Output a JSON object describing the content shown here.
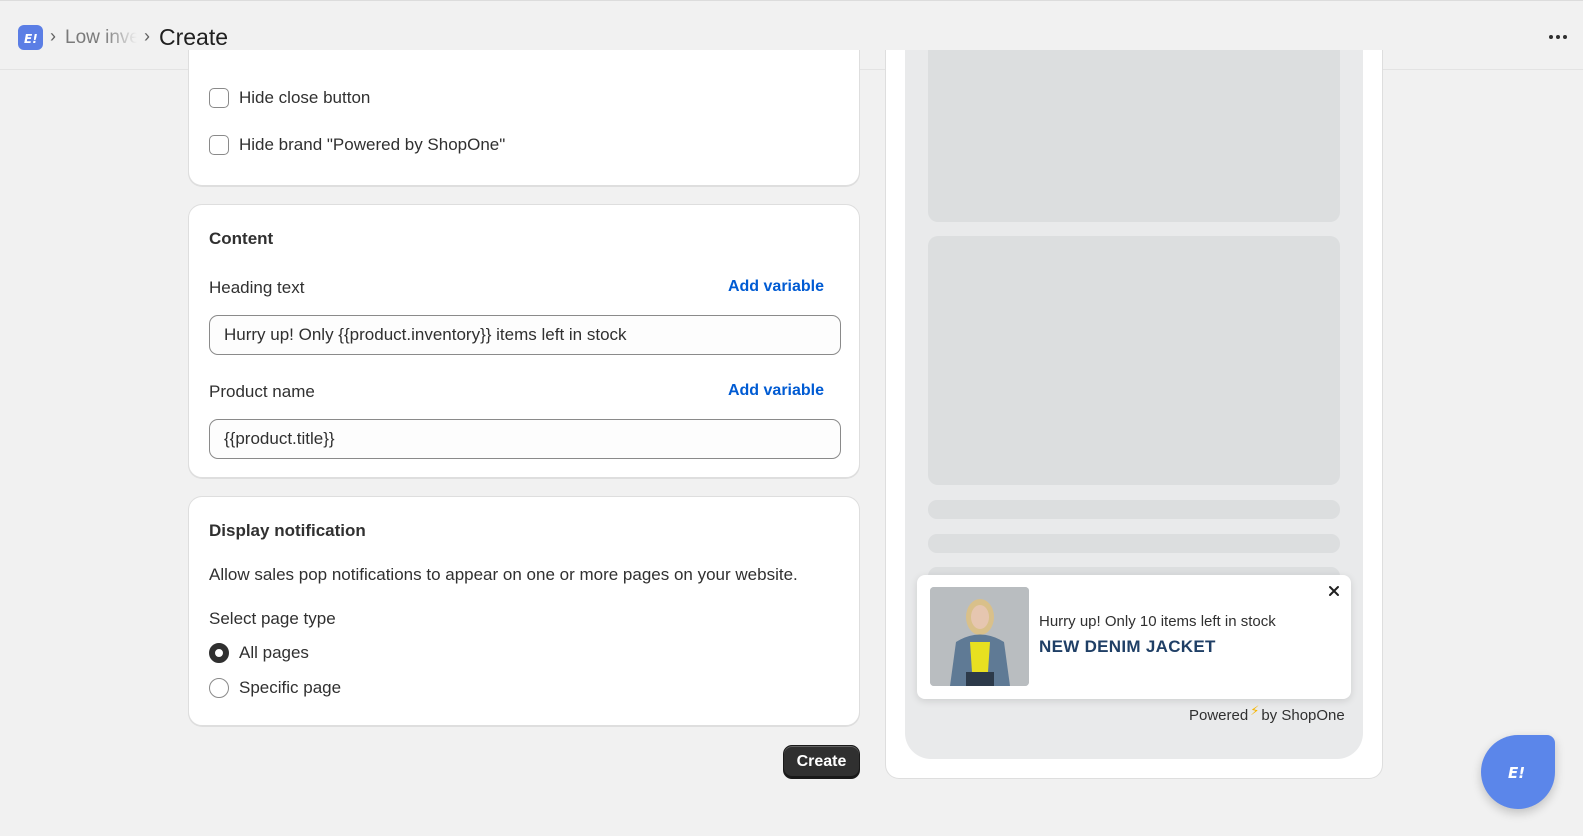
{
  "topbar": {
    "app_icon": "app-logo-icon",
    "breadcrumb_parent": "Low inventory",
    "page_title": "Create",
    "more_icon": "more-horizontal-icon"
  },
  "display_options": {
    "hide_close_label": "Hide close button",
    "hide_close_checked": false,
    "hide_brand_label": "Hide brand \"Powered by ShopOne\"",
    "hide_brand_checked": false
  },
  "content": {
    "title": "Content",
    "heading_label": "Heading text",
    "heading_add_variable": "Add variable",
    "heading_value": "Hurry up! Only {{product.inventory}} items left in stock",
    "product_label": "Product name",
    "product_add_variable": "Add variable",
    "product_value": "{{product.title}}"
  },
  "display_notification": {
    "title": "Display notification",
    "description": "Allow sales pop notifications to appear on one or more pages on your website.",
    "select_label": "Select page type",
    "options": [
      {
        "label": "All pages",
        "checked": true
      },
      {
        "label": "Specific page",
        "checked": false
      }
    ]
  },
  "actions": {
    "create_label": "Create"
  },
  "preview": {
    "notification_heading": "Hurry up! Only 10 items left in stock",
    "notification_product": "NEW DENIM JACKET",
    "close_icon": "close-icon",
    "powered_prefix": "Powered",
    "powered_suffix": "by ShopOne",
    "bolt_icon": "lightning-icon"
  },
  "colors": {
    "link": "#005bd3",
    "primary_button": "#303030",
    "product_name": "#1f3f66",
    "fab": "#5b86ea"
  }
}
